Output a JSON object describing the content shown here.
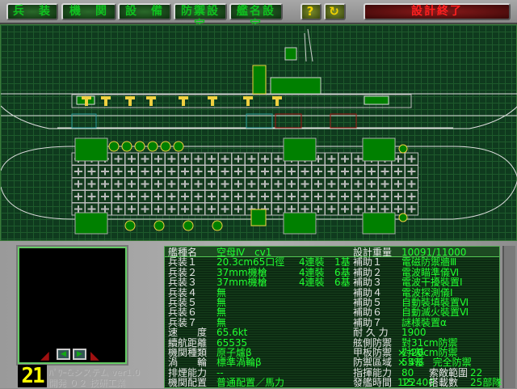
{
  "toolbar": {
    "buttons": [
      "兵　装",
      "機　関",
      "設　備",
      "防禦設定",
      "艦名設定"
    ],
    "help": "?",
    "undo": "↻",
    "finish": "設計終了"
  },
  "viewer": {
    "ship_number": "21",
    "credit_line1": "ﾊﾟﾜｰ&システム ver1.0",
    "credit_line2": "開発 ０２ 技研工業",
    "prev_icon": "◀",
    "next_icon": "▶"
  },
  "colors": {
    "blueprint_bg": "#0f3a1e",
    "text_label": "#e8e8e8",
    "text_value": "#20ff30",
    "weapon": "#f0d040",
    "armor": "#008000"
  },
  "left": [
    {
      "label": "艦種名",
      "value": "空母Ⅳ　cv1",
      "mount": "",
      "count": ""
    },
    {
      "label": "兵装１",
      "value": "20.3cm65口徑",
      "mount": "4連裝",
      "count": "1基"
    },
    {
      "label": "兵装２",
      "value": "37mm機槍",
      "mount": "4連裝",
      "count": "6基"
    },
    {
      "label": "兵装３",
      "value": "37mm機槍",
      "mount": "4連裝",
      "count": "6基"
    },
    {
      "label": "兵装４",
      "value": "無",
      "mount": "",
      "count": ""
    },
    {
      "label": "兵装５",
      "value": "無",
      "mount": "",
      "count": ""
    },
    {
      "label": "兵装６",
      "value": "無",
      "mount": "",
      "count": ""
    },
    {
      "label": "兵装７",
      "value": "無",
      "mount": "",
      "count": ""
    },
    {
      "label": "速　　度",
      "value": "65.6kt",
      "mount": "",
      "count": ""
    },
    {
      "label": "續航距離",
      "value": "65535",
      "mount": "",
      "count": ""
    },
    {
      "label": "機関種類",
      "value": "原子爐β",
      "mount": "× 4基",
      "count": ""
    },
    {
      "label": "渦　　輪",
      "value": "標準渦輪β",
      "mount": "× 4基",
      "count": ""
    },
    {
      "label": "排煙能力",
      "value": "--",
      "mount": "",
      "count": ""
    },
    {
      "label": "機関配置",
      "value": "普通配置／馬力",
      "mount": "122400",
      "count": ""
    }
  ],
  "right": [
    {
      "label": "設計重量",
      "value": "10091/11000",
      "label2": "",
      "value2": ""
    },
    {
      "label": "補助１",
      "value": "電磁防禦牆Ⅲ",
      "label2": "",
      "value2": ""
    },
    {
      "label": "補助２",
      "value": "電波瞄準儀Ⅵ",
      "label2": "",
      "value2": ""
    },
    {
      "label": "補助３",
      "value": "電波干擾裝置Ⅰ",
      "label2": "",
      "value2": ""
    },
    {
      "label": "補助４",
      "value": "電波探測儀Ⅰ",
      "label2": "",
      "value2": ""
    },
    {
      "label": "補助５",
      "value": "自動裝填裝置Ⅵ",
      "label2": "",
      "value2": ""
    },
    {
      "label": "補助６",
      "value": "自動滅火裝置Ⅵ",
      "label2": "",
      "value2": ""
    },
    {
      "label": "補助７",
      "value": "謎様裝置α",
      "label2": "",
      "value2": ""
    },
    {
      "label": "耐 久 力",
      "value": "1900",
      "label2": "",
      "value2": ""
    },
    {
      "label": "舷側防禦",
      "value": "對31cm防禦",
      "label2": "",
      "value2": ""
    },
    {
      "label": "甲板防禦",
      "value": "對20cm防禦",
      "label2": "",
      "value2": ""
    },
    {
      "label": "防禦區域",
      "value": "55%　完全防禦",
      "label2": "",
      "value2": ""
    },
    {
      "label": "指揮能力",
      "value": "80",
      "label2": "索敵範圍",
      "value2": "22"
    },
    {
      "label": "發艦時間",
      "value": "15",
      "label2": "搭載數",
      "value2": "25部隊"
    }
  ]
}
